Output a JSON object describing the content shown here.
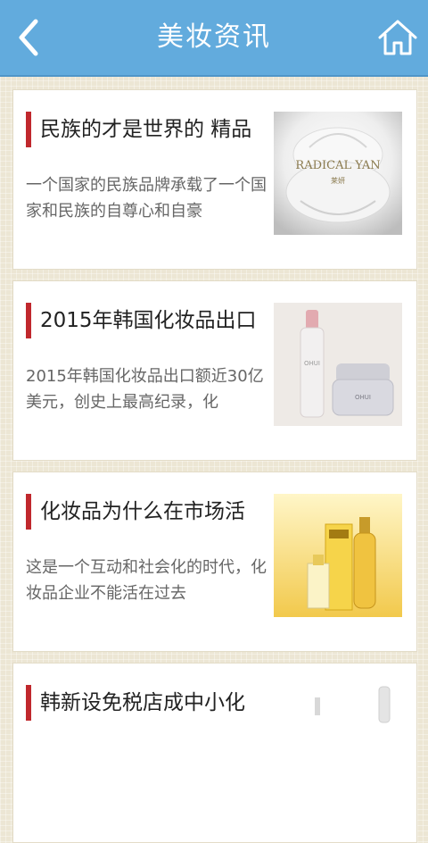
{
  "header": {
    "title": "美妆资讯",
    "back_icon": "chevron-left-icon",
    "home_icon": "home-icon",
    "color": "#62abdd"
  },
  "articles": [
    {
      "title": "民族的才是世界的 精品",
      "desc": "一个国家的民族品牌承载了一个国家和民族的自尊心和自豪",
      "image": {
        "kind": "white-rose-brand",
        "brand": "RADICAL YAN",
        "brand_cn": "莱妍"
      }
    },
    {
      "title": "2015年韩国化妆品出口",
      "desc": "2015年韩国化妆品出口额近30亿美元，创史上最高纪录，化",
      "image": {
        "kind": "ohui-products",
        "brand": "OHUI",
        "brand2": "OHUI"
      }
    },
    {
      "title": "化妆品为什么在市场活",
      "desc": "这是一个互动和社会化的时代，化妆品企业不能活在过去",
      "image": {
        "kind": "gold-bottles"
      }
    },
    {
      "title": "韩新设免税店成中小化",
      "desc": "",
      "image": {
        "kind": "white-bottles"
      }
    }
  ],
  "colors": {
    "accent_bar": "#c0282d",
    "page_bg": "#ece6d4"
  }
}
